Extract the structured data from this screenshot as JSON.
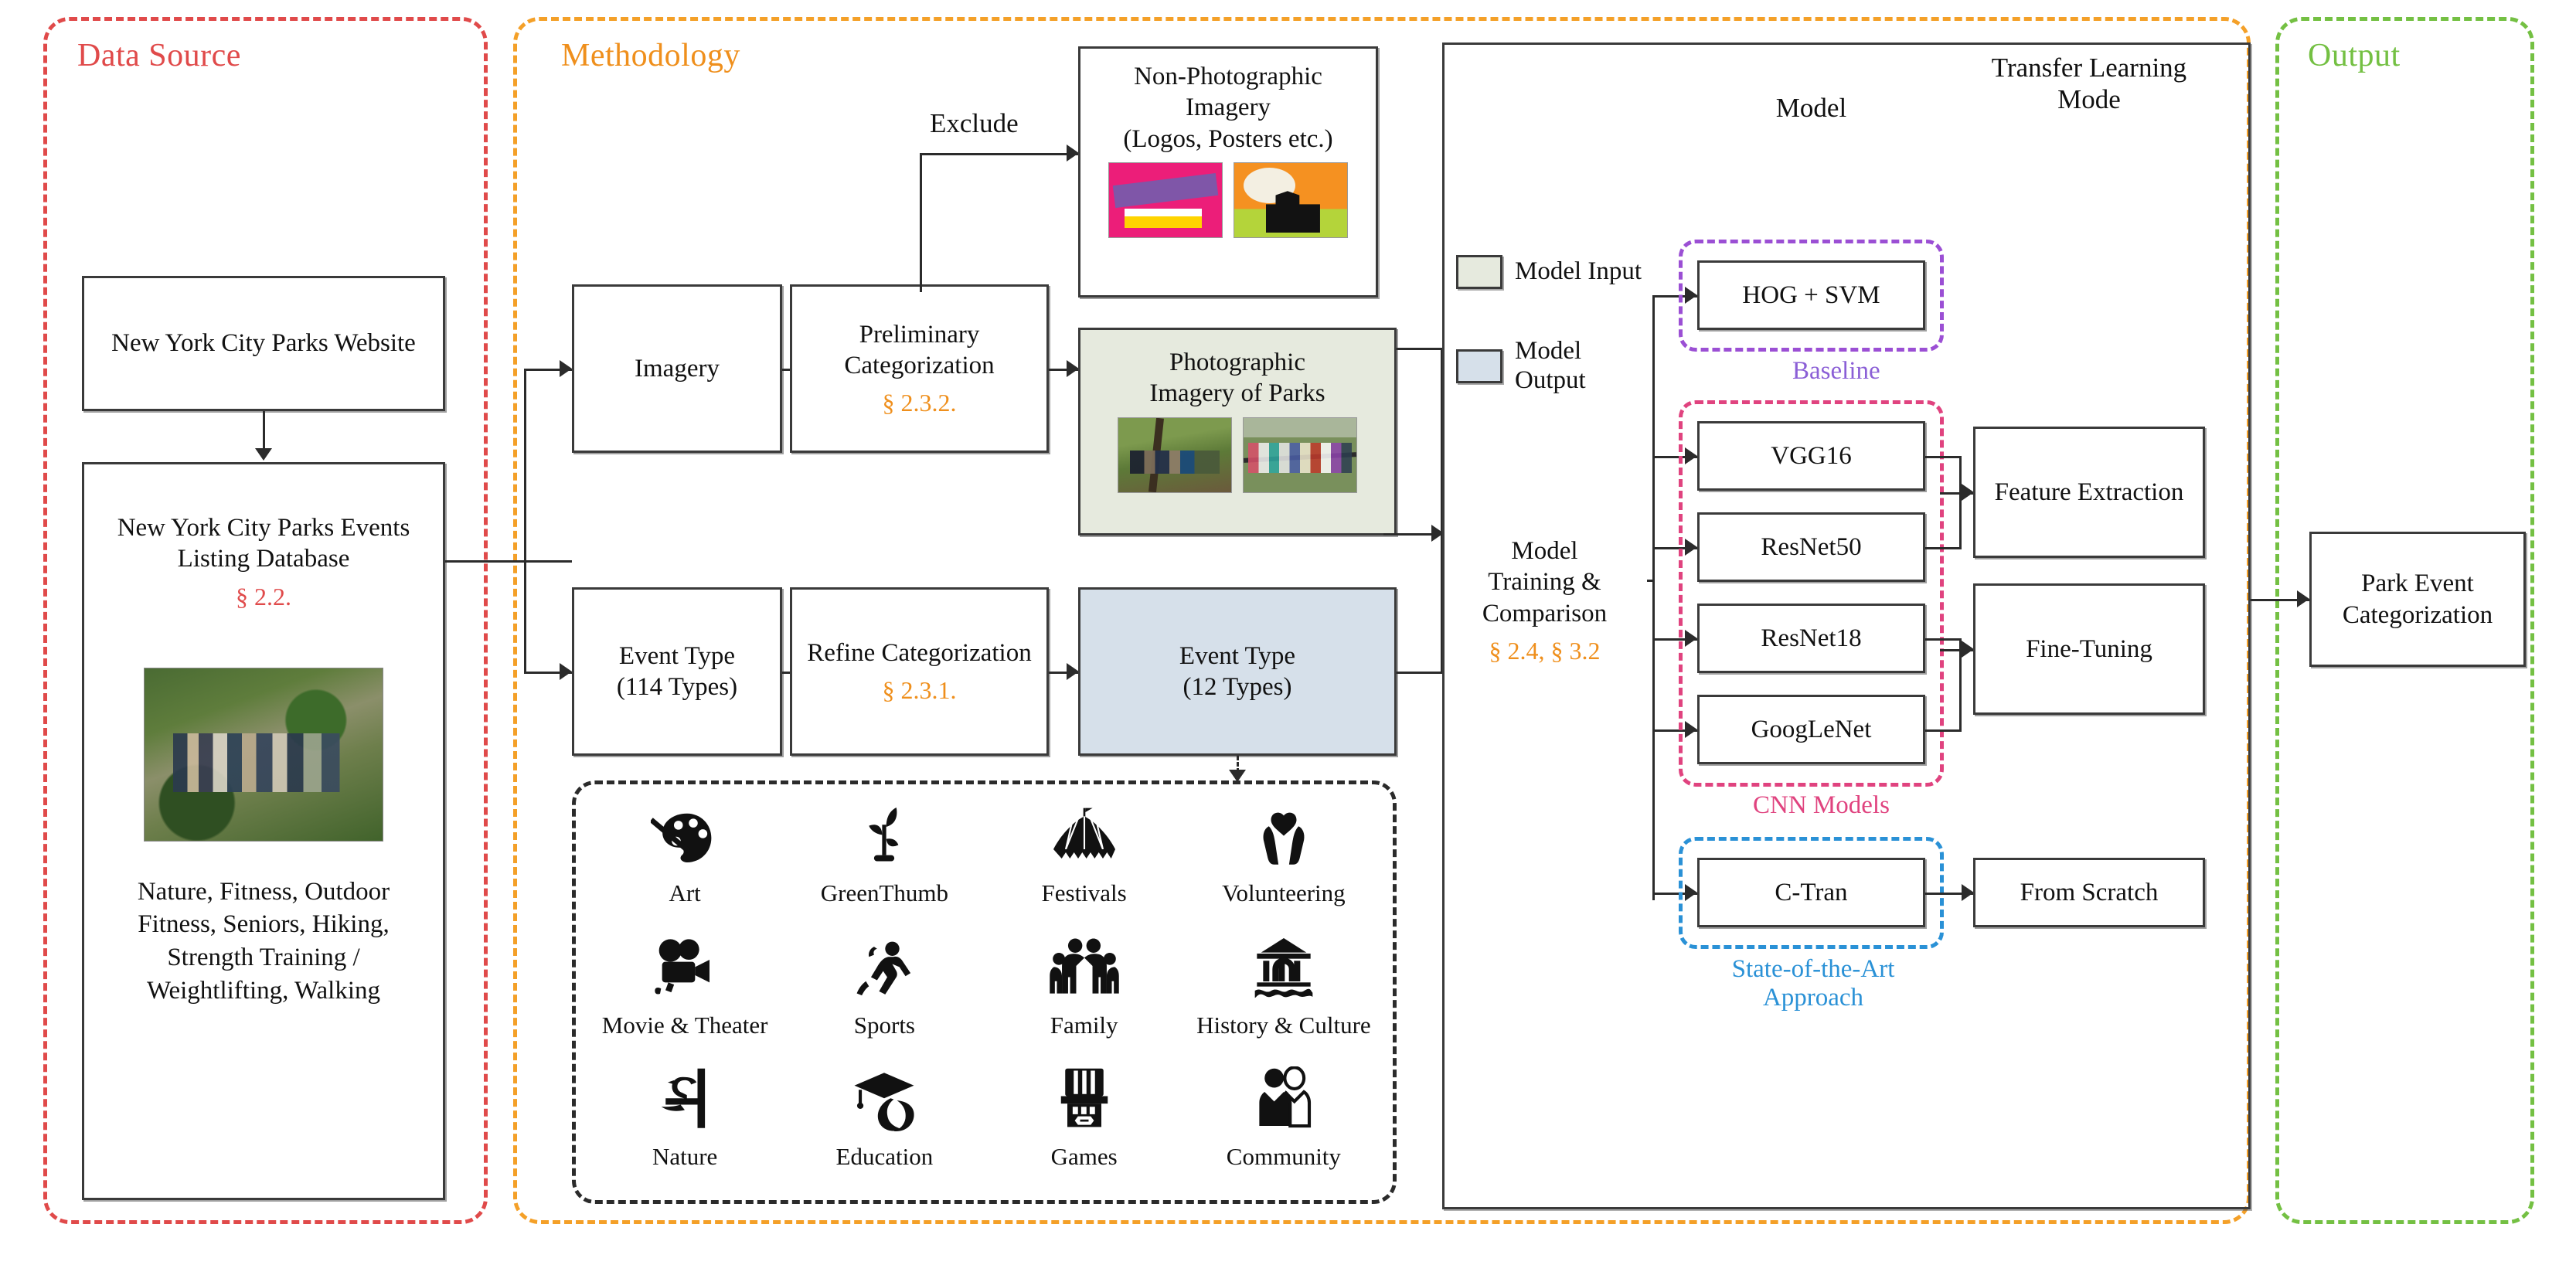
{
  "regions": {
    "data_source": {
      "title": "Data Source",
      "color": "#e04a4a"
    },
    "methodology": {
      "title": "Methodology",
      "color": "#ef8f1c"
    },
    "output": {
      "title": "Output",
      "color": "#74c043"
    }
  },
  "data_source": {
    "website_box": "New York City Parks Website",
    "events_box_title": "New York City Parks Events Listing Database",
    "events_box_section": "§ 2.2.",
    "events_keywords": "Nature, Fitness, Outdoor Fitness, Seniors, Hiking, Strength Training / Weightlifting, Walking",
    "photo_alt": "park-hiking-group-photo"
  },
  "methodology": {
    "imagery_box": "Imagery",
    "preliminary_categorization": {
      "label": "Preliminary Categorization",
      "section": "§ 2.3.2."
    },
    "exclude_label": "Exclude",
    "non_photographic": {
      "line1": "Non-Photographic",
      "line2": "Imagery",
      "line3": "(Logos, Posters etc.)"
    },
    "photographic": {
      "line1": "Photographic",
      "line2": "Imagery of Parks"
    },
    "event_type_114": {
      "line1": "Event Type",
      "line2": "(114 Types)"
    },
    "refine_categorization": {
      "label": "Refine Categorization",
      "section": "§ 2.3.1."
    },
    "event_type_12": {
      "line1": "Event Type",
      "line2": "(12 Types)"
    },
    "categories": [
      {
        "label": "Art",
        "icon": "palette-icon"
      },
      {
        "label": "GreenThumb",
        "icon": "seedling-icon"
      },
      {
        "label": "Festivals",
        "icon": "circus-tent-icon"
      },
      {
        "label": "Volunteering",
        "icon": "heart-in-hands-icon"
      },
      {
        "label": "Movie & Theater",
        "icon": "movie-camera-icon"
      },
      {
        "label": "Sports",
        "icon": "runner-icon"
      },
      {
        "label": "Family",
        "icon": "family-group-icon"
      },
      {
        "label": "History & Culture",
        "icon": "monument-icon"
      },
      {
        "label": "Nature",
        "icon": "bird-on-branch-icon"
      },
      {
        "label": "Education",
        "icon": "graduation-cap-icon"
      },
      {
        "label": "Games",
        "icon": "game-booth-icon"
      },
      {
        "label": "Community",
        "icon": "two-people-icon"
      }
    ]
  },
  "training": {
    "model_training": {
      "line1": "Model",
      "line2": "Training &",
      "line3": "Comparison",
      "section": "§ 2.4, § 3.2"
    },
    "header_model": "Model",
    "header_transfer_learning": "Transfer Learning Mode",
    "legend": [
      {
        "label": "Model Input",
        "color": "#e6eade"
      },
      {
        "label": "Model Output",
        "color": "#d6e0ea"
      }
    ],
    "baseline": {
      "model": "HOG + SVM",
      "group_label": "Baseline",
      "color": "#8b5fd6"
    },
    "cnn": {
      "models": [
        "VGG16",
        "ResNet50",
        "ResNet18",
        "GoogLeNet"
      ],
      "group_label": "CNN Models",
      "color": "#e0437f"
    },
    "sota": {
      "model": "C-Tran",
      "group_label": "State-of-the-Art Approach",
      "color": "#2a91d6"
    },
    "transfer_modes": [
      "Feature Extraction",
      "Fine-Tuning",
      "From Scratch"
    ]
  },
  "output": {
    "park_event": {
      "line1": "Park Event",
      "line2": "Categorization"
    }
  }
}
